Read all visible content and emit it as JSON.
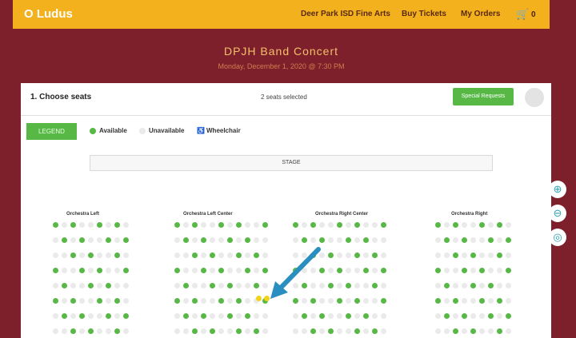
{
  "header": {
    "logo": "O Ludus",
    "nav": [
      "Deer Park ISD Fine Arts",
      "Buy Tickets",
      "My Orders"
    ],
    "cart_count": "0",
    "cart_icon": "cart-icon"
  },
  "event": {
    "title": "DPJH Band Concert",
    "subtitle": "Monday, December 1, 2020 @ 7:30 PM"
  },
  "seating": {
    "step_title": "1. Choose seats",
    "selected_text": "2 seats selected",
    "continue_label": "Special Requests",
    "legend_label": "LEGEND",
    "legend": [
      "Available",
      "Unavailable",
      "Wheelchair"
    ],
    "stage_label": "STAGE",
    "sections": [
      "Orchestra Left",
      "Orchestra Left Center",
      "Orchestra Right Center",
      "Orchestra Right"
    ]
  },
  "colors": {
    "header": "#f2b11d",
    "maroon": "#7e1f2c",
    "available": "#57b846",
    "selected": "#f0d21b",
    "arrow": "#2a8fc0"
  },
  "zoom_controls": [
    "zoom-in-icon",
    "zoom-out-icon",
    "recenter-icon"
  ]
}
